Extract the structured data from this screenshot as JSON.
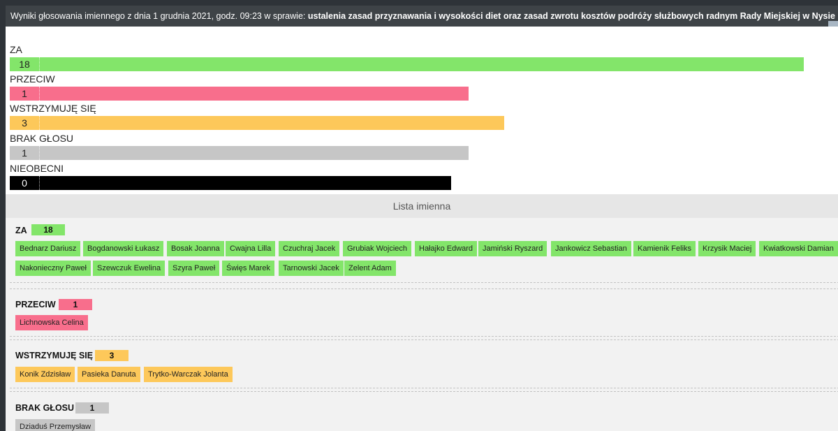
{
  "title": {
    "prefix": "Wyniki głosowania imiennego z dnia 1 grudnia 2021, godz. 09:23 w sprawie:",
    "subject": "ustalenia zasad przyznawania i wysokości diet oraz zasad zwrotu kosztów podróży służbowych radnym Rady Miejskiej w Nysie"
  },
  "summary": [
    {
      "label": "ZA",
      "count": "18",
      "color": "#83e56a"
    },
    {
      "label": "PRZECIW",
      "count": "1",
      "color": "#f86e8c"
    },
    {
      "label": "WSTRZYMUJĘ SIĘ",
      "count": "3",
      "color": "#fdc85a"
    },
    {
      "label": "BRAK GŁOSU",
      "count": "1",
      "color": "#c6c6c6"
    },
    {
      "label": "NIEOBECNI",
      "count": "0",
      "color": "#000000"
    }
  ],
  "list_header": "Lista imienna",
  "groups": {
    "za": {
      "title": "ZA",
      "count": "18",
      "names": [
        "Bednarz Dariusz",
        "Bogdanowski Łukasz",
        "Bosak Joanna",
        "Cwajna Lilla",
        "Czuchraj Jacek",
        "Grubiak Wojciech",
        "Hałajko Edward",
        "Jamiński Ryszard",
        "Jankowicz Sebastian",
        "Kamienik Feliks",
        "Krzysik Maciej",
        "Kwiatkowski Damian",
        "Nakonieczny Paweł",
        "Szewczuk Ewelina",
        "Szyra Paweł",
        "Święs Marek",
        "Tarnowski Jacek",
        "Zelent Adam"
      ]
    },
    "przeciw": {
      "title": "PRZECIW",
      "count": "1",
      "names": [
        "Lichnowska Celina"
      ]
    },
    "wstrzymuje": {
      "title": "WSTRZYMUJĘ SIĘ",
      "count": "3",
      "names": [
        "Konik Zdzisław",
        "Pasieka Danuta",
        "Trytko-Warczak Jolanta"
      ]
    },
    "brak": {
      "title": "BRAK GŁOSU",
      "count": "1",
      "names": [
        "Dziaduś Przemysław"
      ]
    }
  }
}
